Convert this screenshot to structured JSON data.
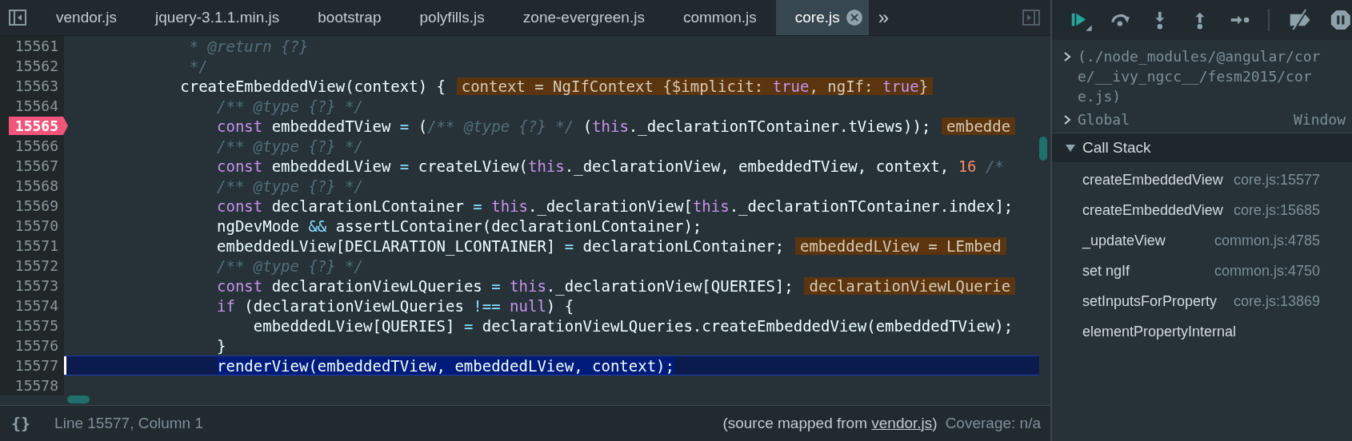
{
  "tabs": [
    {
      "label": "vendor.js",
      "selected": false
    },
    {
      "label": "jquery-3.1.1.min.js",
      "selected": false
    },
    {
      "label": "bootstrap",
      "selected": false
    },
    {
      "label": "polyfills.js",
      "selected": false
    },
    {
      "label": "zone-evergreen.js",
      "selected": false
    },
    {
      "label": "common.js",
      "selected": false
    },
    {
      "label": "core.js",
      "selected": true
    }
  ],
  "tab_overflow": "»",
  "lines": [
    {
      "number": "15561",
      "breakpoint": false,
      "current": false,
      "kind": "doc_comment",
      "tokens": [
        {
          "kind": "comment",
          "text": "* @return {?}"
        }
      ]
    },
    {
      "number": "15562",
      "breakpoint": false,
      "current": false,
      "kind": "doc_comment",
      "tokens": [
        {
          "kind": "comment",
          "text": "*/"
        }
      ]
    },
    {
      "number": "15563",
      "breakpoint": false,
      "current": false,
      "kind": "method",
      "tokens": [
        {
          "kind": "plain",
          "text": "createEmbeddedView(context) {"
        }
      ],
      "inline_value": [
        {
          "kind": "plain",
          "text": "context = NgIfContext {$implicit: "
        },
        {
          "kind": "keyword",
          "text": "true"
        },
        {
          "kind": "plain",
          "text": ", ngIf: "
        },
        {
          "kind": "keyword",
          "text": "true"
        },
        {
          "kind": "plain",
          "text": "}"
        }
      ]
    },
    {
      "number": "15564",
      "breakpoint": false,
      "current": false,
      "kind": "body",
      "tokens": [
        {
          "kind": "comment",
          "text": "/** @type {?} */"
        }
      ]
    },
    {
      "number": "15565",
      "breakpoint": true,
      "current": false,
      "kind": "body",
      "tokens": [
        {
          "kind": "keyword",
          "text": "const"
        },
        {
          "kind": "plain",
          "text": " embeddedTView "
        },
        {
          "kind": "operator",
          "text": "="
        },
        {
          "kind": "plain",
          "text": " ("
        },
        {
          "kind": "comment",
          "text": "/** @type {?} */"
        },
        {
          "kind": "plain",
          "text": " ("
        },
        {
          "kind": "keyword",
          "text": "this"
        },
        {
          "kind": "plain",
          "text": "._declarationTContainer.tViews));"
        }
      ],
      "inline_value": [
        {
          "kind": "plain",
          "text": "embedde"
        }
      ]
    },
    {
      "number": "15566",
      "breakpoint": false,
      "current": false,
      "kind": "body",
      "tokens": [
        {
          "kind": "comment",
          "text": "/** @type {?} */"
        }
      ]
    },
    {
      "number": "15567",
      "breakpoint": false,
      "current": false,
      "kind": "body",
      "tokens": [
        {
          "kind": "keyword",
          "text": "const"
        },
        {
          "kind": "plain",
          "text": " embeddedLView "
        },
        {
          "kind": "operator",
          "text": "="
        },
        {
          "kind": "plain",
          "text": " createLView("
        },
        {
          "kind": "keyword",
          "text": "this"
        },
        {
          "kind": "plain",
          "text": "._declarationView, embeddedTView, context, "
        },
        {
          "kind": "number",
          "text": "16 "
        },
        {
          "kind": "comment",
          "text": "/*"
        }
      ]
    },
    {
      "number": "15568",
      "breakpoint": false,
      "current": false,
      "kind": "body",
      "tokens": [
        {
          "kind": "comment",
          "text": "/** @type {?} */"
        }
      ]
    },
    {
      "number": "15569",
      "breakpoint": false,
      "current": false,
      "kind": "body",
      "tokens": [
        {
          "kind": "keyword",
          "text": "const"
        },
        {
          "kind": "plain",
          "text": " declarationLContainer "
        },
        {
          "kind": "operator",
          "text": "= "
        },
        {
          "kind": "keyword",
          "text": "this"
        },
        {
          "kind": "plain",
          "text": "._declarationView["
        },
        {
          "kind": "keyword",
          "text": "this"
        },
        {
          "kind": "plain",
          "text": "._declarationTContainer.index];"
        }
      ]
    },
    {
      "number": "15570",
      "breakpoint": false,
      "current": false,
      "kind": "body",
      "tokens": [
        {
          "kind": "plain",
          "text": "ngDevMode "
        },
        {
          "kind": "operator",
          "text": "&&"
        },
        {
          "kind": "plain",
          "text": " assertLContainer(declarationLContainer);"
        }
      ]
    },
    {
      "number": "15571",
      "breakpoint": false,
      "current": false,
      "kind": "body",
      "tokens": [
        {
          "kind": "plain",
          "text": "embeddedLView[DECLARATION_LCONTAINER] "
        },
        {
          "kind": "operator",
          "text": "="
        },
        {
          "kind": "plain",
          "text": " declarationLContainer;"
        }
      ],
      "inline_value": [
        {
          "kind": "plain",
          "text": "embeddedLView = LEmbed"
        }
      ]
    },
    {
      "number": "15572",
      "breakpoint": false,
      "current": false,
      "kind": "body",
      "tokens": [
        {
          "kind": "comment",
          "text": "/** @type {?} */"
        }
      ]
    },
    {
      "number": "15573",
      "breakpoint": false,
      "current": false,
      "kind": "body",
      "tokens": [
        {
          "kind": "keyword",
          "text": "const"
        },
        {
          "kind": "plain",
          "text": " declarationViewLQueries "
        },
        {
          "kind": "operator",
          "text": "= "
        },
        {
          "kind": "keyword",
          "text": "this"
        },
        {
          "kind": "plain",
          "text": "._declarationView[QUERIES];"
        }
      ],
      "inline_value": [
        {
          "kind": "plain",
          "text": "declarationViewLQuerie"
        }
      ]
    },
    {
      "number": "15574",
      "breakpoint": false,
      "current": false,
      "kind": "body",
      "tokens": [
        {
          "kind": "keyword",
          "text": "if"
        },
        {
          "kind": "plain",
          "text": " (declarationViewLQueries "
        },
        {
          "kind": "operator",
          "text": "!== "
        },
        {
          "kind": "keyword",
          "text": "null"
        },
        {
          "kind": "plain",
          "text": ") {"
        }
      ]
    },
    {
      "number": "15575",
      "breakpoint": false,
      "current": false,
      "kind": "block",
      "tokens": [
        {
          "kind": "plain",
          "text": "embeddedLView[QUERIES] "
        },
        {
          "kind": "operator",
          "text": "="
        },
        {
          "kind": "plain",
          "text": " declarationViewLQueries.createEmbeddedView(embeddedTView);"
        }
      ]
    },
    {
      "number": "15576",
      "breakpoint": false,
      "current": false,
      "kind": "body",
      "tokens": [
        {
          "kind": "plain",
          "text": "}"
        }
      ]
    },
    {
      "number": "15577",
      "breakpoint": false,
      "current": true,
      "kind": "body",
      "tokens": [
        {
          "kind": "plain",
          "text": "renderView(embeddedTView, embeddedLView, context);"
        }
      ]
    },
    {
      "number": "15578",
      "breakpoint": false,
      "current": false
    }
  ],
  "status_bar": {
    "pretty_print": "{}",
    "position": "Line 15577, Column 1",
    "source_before": "(source mapped from ",
    "source_link": "vendor.js",
    "source_after": ")",
    "coverage": "Coverage: n/a"
  },
  "scope": [
    {
      "label": "(./node_modules/@angular/core/__ivy_ngcc__/fesm2015/core.js)",
      "expanded": false
    },
    {
      "label": "Global",
      "value": "Window",
      "expanded": false
    }
  ],
  "call_stack": {
    "title": "Call Stack",
    "expanded": true,
    "frames": [
      {
        "name": "createEmbeddedView",
        "location": "core.js:15577"
      },
      {
        "name": "createEmbeddedView",
        "location": "core.js:15685"
      },
      {
        "name": "_updateView",
        "location": "common.js:4785"
      },
      {
        "name": "set ngIf",
        "location": "common.js:4750"
      },
      {
        "name": "setInputsForProperty",
        "location": "core.js:13869"
      },
      {
        "name": "elementPropertyInternal"
      }
    ]
  }
}
